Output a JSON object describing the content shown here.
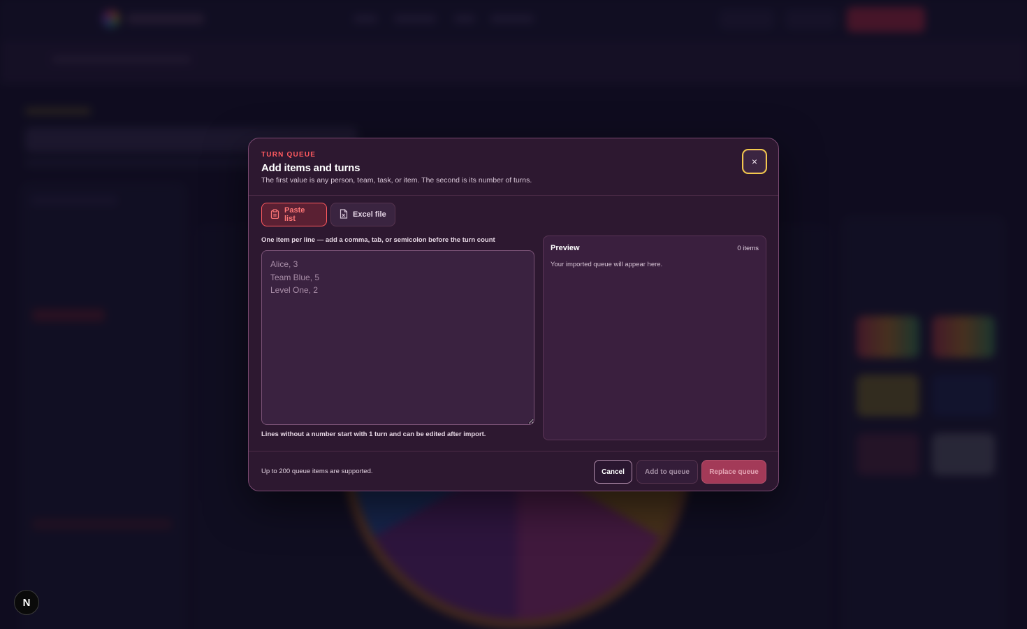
{
  "dialog": {
    "kicker": "TURN QUEUE",
    "title": "Add items and turns",
    "description": "The first value is any person, team, task, or item. The second is its number of turns.",
    "close_label": "×"
  },
  "tabs": [
    {
      "label": "Paste list",
      "icon": "clipboard-icon",
      "active": true
    },
    {
      "label": "Excel file",
      "icon": "excel-file-icon",
      "active": false
    }
  ],
  "paste": {
    "label": "One item per line — add a comma, tab, or semicolon before the turn count",
    "value": "",
    "placeholder": "Alice, 3\nTeam Blue, 5\nLevel One, 2",
    "helper": "Lines without a number start with 1 turn and can be edited after import."
  },
  "preview": {
    "title": "Preview",
    "count": "0 items",
    "empty_text": "Your imported queue will appear here."
  },
  "footer": {
    "note": "Up to 200 queue items are supported.",
    "cancel_label": "Cancel",
    "add_label": "Add to queue",
    "replace_label": "Replace queue"
  },
  "badge": {
    "label": "N"
  },
  "colors": {
    "accent": "#ff5a5f",
    "focus_ring": "#f2c94c",
    "modal_bg": "#2d1830",
    "primary_disabled": "#a33a58"
  }
}
